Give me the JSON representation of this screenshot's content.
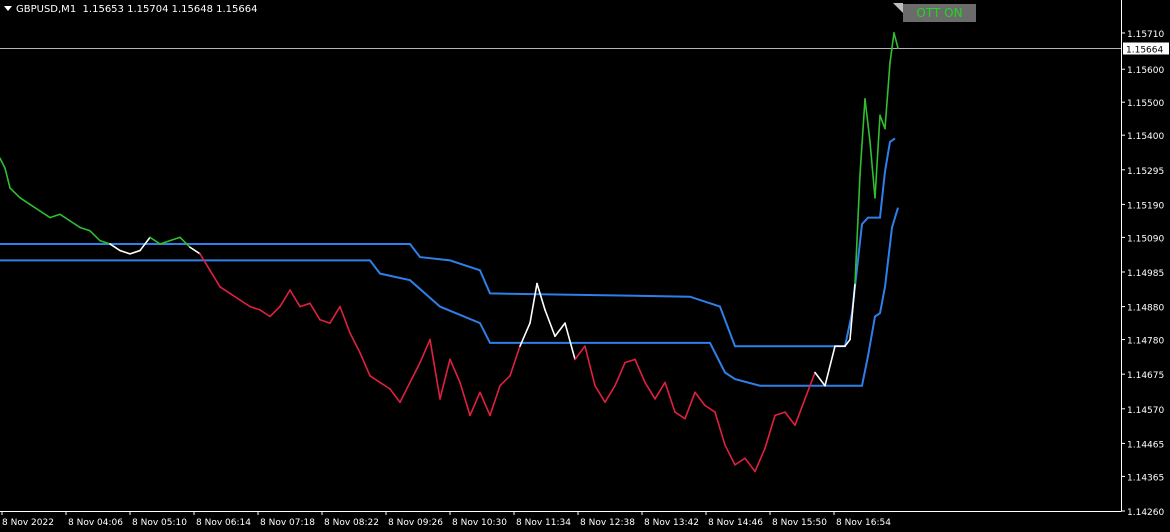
{
  "header": {
    "symbol": "GBPUSD,M1",
    "ohlc": "1.15653 1.15704 1.15648 1.15664"
  },
  "ott_button": {
    "label": "OTT ON"
  },
  "colors": {
    "background": "#000000",
    "up": "#2fbf2f",
    "down": "#e0203f",
    "neutral": "#ffffff",
    "ott": "#2f7fe8",
    "axis": "#ffffff",
    "price_line": "#b4b4b4"
  },
  "chart_data": {
    "type": "line",
    "title": "",
    "xlabel": "",
    "ylabel": "",
    "ylim": [
      1.1426,
      1.1581
    ],
    "y_ticks": [
      "1.15710",
      "1.15600",
      "1.15500",
      "1.15400",
      "1.15295",
      "1.15190",
      "1.15090",
      "1.14985",
      "1.14880",
      "1.14780",
      "1.14675",
      "1.14570",
      "1.14465",
      "1.14365",
      "1.14260"
    ],
    "x_ticks": [
      "8 Nov 2022",
      "8 Nov 04:06",
      "8 Nov 05:10",
      "8 Nov 06:14",
      "8 Nov 07:18",
      "8 Nov 08:22",
      "8 Nov 09:26",
      "8 Nov 10:30",
      "8 Nov 11:34",
      "8 Nov 12:38",
      "8 Nov 13:42",
      "8 Nov 14:46",
      "8 Nov 15:50",
      "8 Nov 16:54"
    ],
    "current_price": "1.15664",
    "series": [
      {
        "role": "price",
        "x": [
          0,
          5,
          10,
          20,
          30,
          40,
          50,
          60,
          70,
          80,
          90,
          100,
          110,
          120,
          130,
          140,
          150,
          160,
          170,
          180,
          190,
          200,
          210,
          220,
          230,
          240,
          250,
          260,
          270,
          280,
          290,
          300,
          310,
          320,
          330,
          340,
          350,
          360,
          370,
          380,
          390,
          400,
          410,
          420,
          430,
          440,
          450,
          460,
          470,
          480,
          490,
          500,
          510,
          520,
          530,
          537,
          545,
          555,
          565,
          575,
          585,
          595,
          605,
          615,
          625,
          635,
          645,
          655,
          665,
          675,
          685,
          695,
          705,
          715,
          725,
          735,
          745,
          755,
          765,
          775,
          785,
          795,
          805,
          815,
          825,
          835,
          845,
          850,
          855,
          860,
          865,
          870,
          875,
          880,
          885,
          890,
          894,
          898
        ],
        "values": [
          1.1533,
          1.153,
          1.1524,
          1.1521,
          1.1519,
          1.1517,
          1.1515,
          1.1516,
          1.1514,
          1.1512,
          1.1511,
          1.1508,
          1.1507,
          1.1505,
          1.1504,
          1.1505,
          1.1509,
          1.1507,
          1.1508,
          1.1509,
          1.1506,
          1.1504,
          1.1499,
          1.1494,
          1.1492,
          1.149,
          1.1488,
          1.1487,
          1.1485,
          1.1488,
          1.1493,
          1.1488,
          1.1489,
          1.1484,
          1.1483,
          1.1488,
          1.148,
          1.1474,
          1.1467,
          1.1465,
          1.1463,
          1.1459,
          1.1465,
          1.1471,
          1.1478,
          1.146,
          1.1472,
          1.1465,
          1.1455,
          1.1462,
          1.1455,
          1.1464,
          1.1467,
          1.1476,
          1.1483,
          1.1495,
          1.1487,
          1.1479,
          1.1483,
          1.1472,
          1.1476,
          1.1464,
          1.1459,
          1.1464,
          1.1471,
          1.1472,
          1.1465,
          1.146,
          1.1465,
          1.1456,
          1.1454,
          1.1462,
          1.1458,
          1.1456,
          1.1446,
          1.144,
          1.1442,
          1.1438,
          1.1445,
          1.1455,
          1.1456,
          1.1452,
          1.146,
          1.1468,
          1.1464,
          1.1476,
          1.1476,
          1.1478,
          1.1495,
          1.1528,
          1.1551,
          1.1538,
          1.1521,
          1.1546,
          1.1542,
          1.1562,
          1.1571,
          1.15664
        ]
      },
      {
        "role": "ott-upper",
        "x": [
          0,
          410,
          420,
          450,
          480,
          490,
          690,
          720,
          735,
          760,
          845,
          852,
          862,
          868,
          875,
          880,
          885,
          890,
          895
        ],
        "values": [
          1.1507,
          1.1507,
          1.1503,
          1.1502,
          1.1499,
          1.1492,
          1.1491,
          1.1488,
          1.1476,
          1.1476,
          1.1476,
          1.1486,
          1.1513,
          1.1515,
          1.1515,
          1.1515,
          1.1529,
          1.1538,
          1.1539
        ]
      },
      {
        "role": "ott-lower",
        "x": [
          0,
          370,
          380,
          410,
          440,
          480,
          490,
          710,
          725,
          735,
          760,
          862,
          868,
          875,
          880,
          885,
          892,
          898
        ],
        "values": [
          1.1502,
          1.1502,
          1.1498,
          1.1496,
          1.1488,
          1.1483,
          1.1477,
          1.1477,
          1.1468,
          1.1466,
          1.1464,
          1.1464,
          1.1473,
          1.1485,
          1.1486,
          1.1494,
          1.1512,
          1.1518
        ]
      }
    ]
  }
}
